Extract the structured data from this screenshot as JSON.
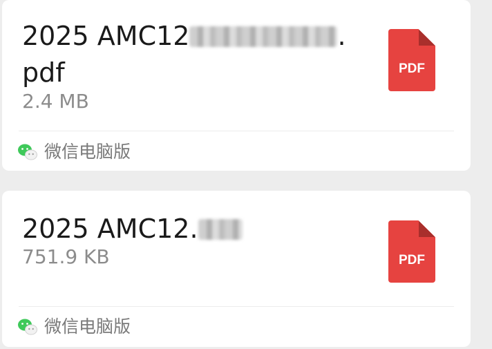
{
  "files": [
    {
      "name_prefix": "2025 AMC12",
      "name_suffix": ".",
      "name_line2": "pdf",
      "size": "2.4 MB",
      "file_type": "PDF",
      "source": "微信电脑版"
    },
    {
      "name_prefix": "2025 AMC12.",
      "size": "751.9 KB",
      "file_type": "PDF",
      "source": "微信电脑版"
    }
  ],
  "colors": {
    "background": "#ededed",
    "card": "#ffffff",
    "pdf_icon": "#e64340",
    "wechat_green": "#3fc95a"
  },
  "icons": [
    "pdf-file-icon",
    "wechat-icon"
  ]
}
